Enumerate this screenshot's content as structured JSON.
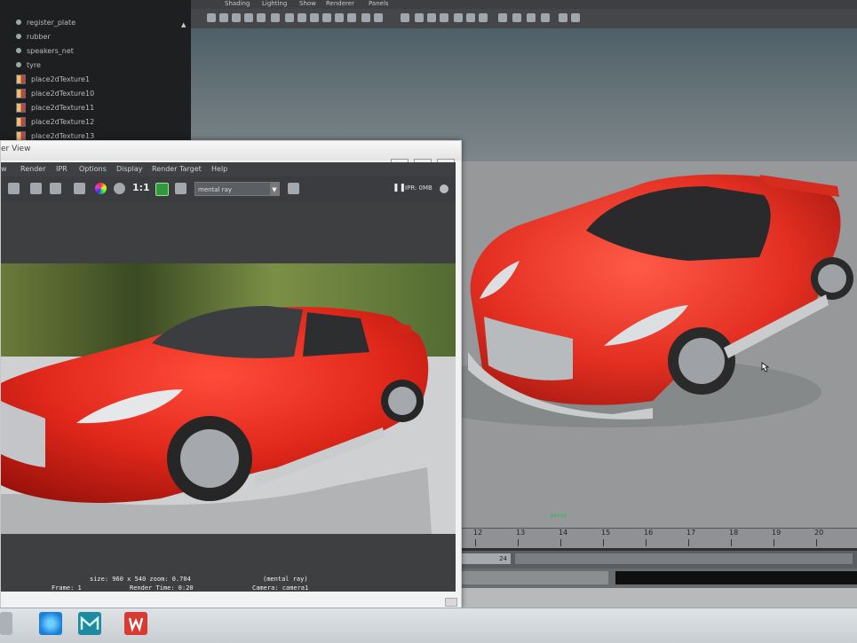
{
  "outliner": {
    "items": [
      {
        "label": "register_plate",
        "icon": "node-icon"
      },
      {
        "label": "rubber",
        "icon": "node-icon"
      },
      {
        "label": "speakers_net",
        "icon": "node-icon"
      },
      {
        "label": "tyre",
        "icon": "node-icon"
      },
      {
        "label": "place2dTexture1",
        "icon": "texture-node-icon"
      },
      {
        "label": "place2dTexture10",
        "icon": "texture-node-icon"
      },
      {
        "label": "place2dTexture11",
        "icon": "texture-node-icon"
      },
      {
        "label": "place2dTexture12",
        "icon": "texture-node-icon"
      },
      {
        "label": "place2dTexture13",
        "icon": "texture-node-icon"
      }
    ],
    "scroll_up": "▲"
  },
  "viewport": {
    "menu": [
      "Shading",
      "Lighting",
      "Show",
      "Renderer",
      "Panels"
    ],
    "camera_label": "persp",
    "car_color": "#e32f22"
  },
  "timeline": {
    "ticks": [
      "12",
      "13",
      "14",
      "15",
      "16",
      "17",
      "18",
      "19",
      "20"
    ],
    "range_end": "24"
  },
  "render_view": {
    "title": "er View",
    "menu": [
      "w",
      "Render",
      "IPR",
      "Options",
      "Display",
      "Render Target",
      "Help"
    ],
    "zoom_ratio": "1:1",
    "renderer": "mental ray",
    "ipr_status": "IPR: 0MB",
    "info": {
      "size_line": "size: 960 x 540  zoom: 0.704",
      "renderer_tag": "(mental ray)",
      "frame": "Frame: 1",
      "render_time": "Render Time: 0:20",
      "camera": "Camera: camera1"
    },
    "window_controls": [
      "▭",
      "▢",
      "✕"
    ]
  },
  "taskbar": {
    "apps": [
      "ie-icon",
      "maya-icon",
      "wps-icon"
    ]
  }
}
